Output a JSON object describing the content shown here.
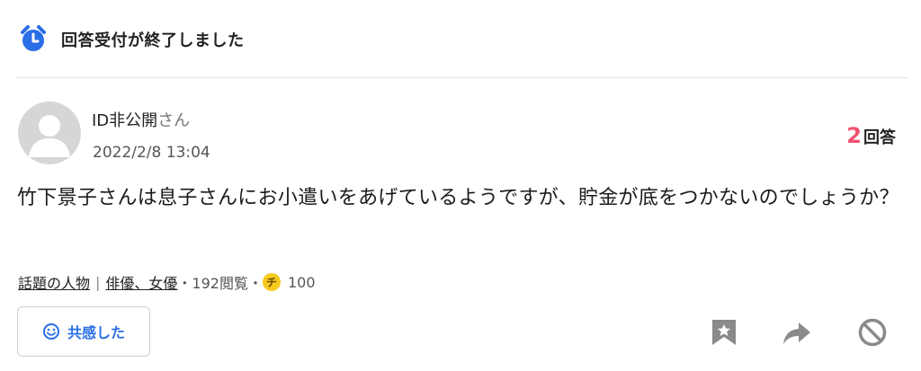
{
  "banner": {
    "text": "回答受付が終了しました",
    "icon": "alarm-clock-icon",
    "icon_color": "#2a6ee8"
  },
  "question": {
    "user": {
      "name": "ID非公開",
      "suffix": "さん",
      "avatar": "default-avatar"
    },
    "date": "2022/2/8 13:04",
    "answers": {
      "count": "2",
      "label": "回答",
      "count_color": "#f0506e"
    },
    "body": "竹下景子さんは息子さんにお小遣いをあげているようですが、貯金が底をつかないのでしょうか？"
  },
  "meta": {
    "category1": "話題の人物",
    "category_sep": "|",
    "category2": "俳優、女優",
    "views": "・192閲覧・",
    "coin_icon": "chiebukuro-coin-icon",
    "coin_label": "チ",
    "coin_value": "100"
  },
  "actions": {
    "empathy_label": "共感した",
    "empathy_icon": "smile-icon",
    "accent": "#2a6ee8",
    "bookmark_icon": "bookmark-icon",
    "share_icon": "share-icon",
    "block_icon": "block-icon"
  }
}
